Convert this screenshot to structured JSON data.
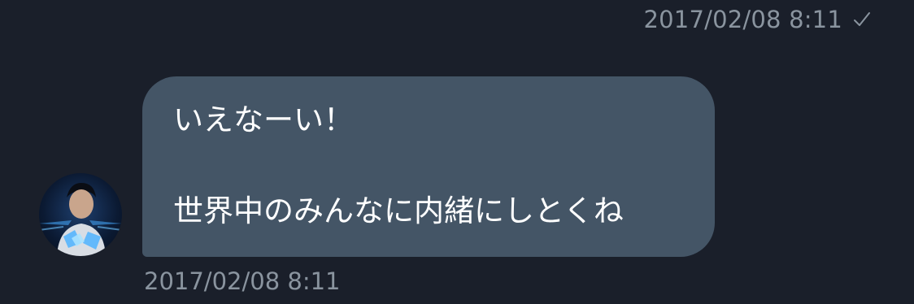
{
  "sent_message": {
    "timestamp": "2017/02/08 8:11",
    "status_icon": "check-icon"
  },
  "received_message": {
    "text_line_1": "いえなーい！",
    "text_line_2": "世界中のみんなに内緒にしとくね",
    "timestamp": "2017/02/08 8:11",
    "avatar_icon": "user-avatar"
  },
  "colors": {
    "background": "#1a1f2a",
    "bubble": "#445566",
    "meta_text": "#8a949f",
    "message_text": "#ffffff"
  }
}
